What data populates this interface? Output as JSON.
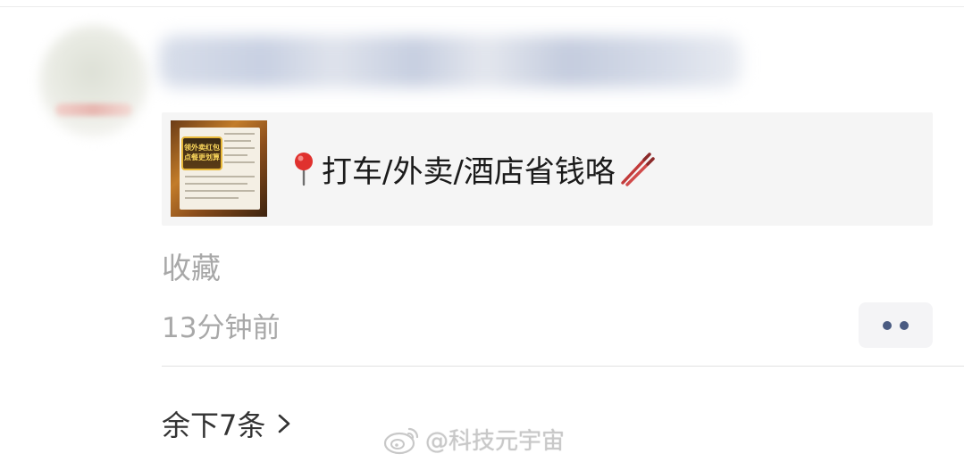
{
  "post": {
    "author_name": "",
    "attachment": {
      "title": "打车/外卖/酒店省钱咯",
      "leading_icon": "round-pushpin-icon",
      "trailing_icon": "chopsticks-icon",
      "thumbnail_badge": "领外卖红包\n点餐更划算"
    },
    "source_label": "收藏",
    "timestamp": "13分钟前",
    "more_button": "more-icon"
  },
  "replies": {
    "remaining_label": "余下7条"
  },
  "watermark": {
    "text": "@科技元宇宙",
    "icon": "weibo-logo-icon"
  },
  "colors": {
    "card_bg": "#f5f5f5",
    "muted_text": "#a8a8a8",
    "more_dots": "#4a5b82",
    "pin_red": "#e0312e"
  }
}
